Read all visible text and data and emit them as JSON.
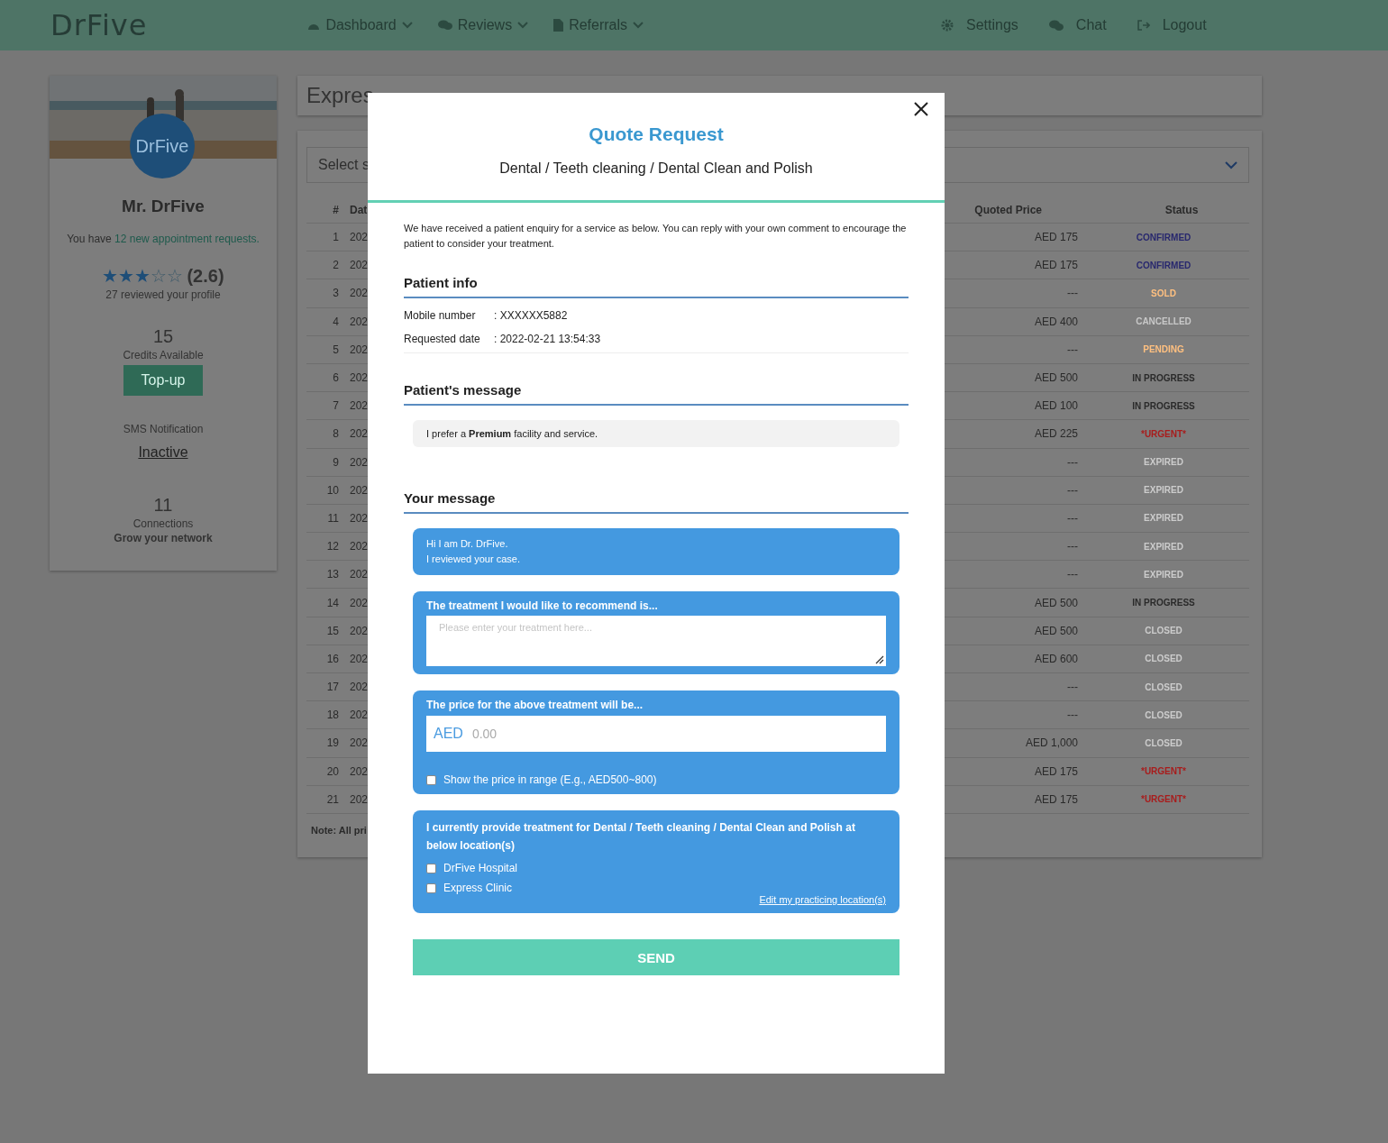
{
  "nav": {
    "logo": "DrFive",
    "menus": [
      {
        "label": "Dashboard"
      },
      {
        "label": "Reviews"
      },
      {
        "label": "Referrals"
      }
    ],
    "actions": [
      {
        "label": "Settings"
      },
      {
        "label": "Chat"
      },
      {
        "label": "Logout"
      }
    ]
  },
  "profile": {
    "avatar": "DrFive",
    "name": "Mr. DrFive",
    "notice": "You have ",
    "notice_link": "12 new appointment requests.",
    "stars": 3,
    "rating": "(2.6)",
    "reviews": "27 reviewed your profile",
    "credits": "15",
    "credits_label": "Credits Available",
    "topup": "Top-up",
    "sms_label": "SMS Notification",
    "sms_status": "Inactive",
    "connections": "11",
    "connections_label": "Connections",
    "grow": "Grow your network"
  },
  "main": {
    "title": "Expres",
    "select_placeholder": "Select s",
    "columns": [
      "#",
      "Dat",
      "Quoted Price",
      "Status"
    ],
    "note": "Note: All pri",
    "rows": [
      {
        "n": "1",
        "date": "202",
        "price": "AED 175",
        "status": "CONFIRMED",
        "color": "#28286e"
      },
      {
        "n": "2",
        "date": "202",
        "price": "AED 175",
        "status": "CONFIRMED",
        "color": "#28286e"
      },
      {
        "n": "3",
        "date": "202",
        "price": "---",
        "status": "SOLD",
        "color": "#ffc080"
      },
      {
        "n": "4",
        "date": "202",
        "price": "AED 400",
        "status": "CANCELLED",
        "color": "#c8c8c8"
      },
      {
        "n": "5",
        "date": "202",
        "price": "---",
        "status": "PENDING",
        "color": "#ffc080"
      },
      {
        "n": "6",
        "date": "202",
        "price": "AED 500",
        "status": "IN PROGRESS",
        "color": "#2a2a2a"
      },
      {
        "n": "7",
        "date": "202",
        "price": "AED 100",
        "status": "IN PROGRESS",
        "color": "#2a2a2a"
      },
      {
        "n": "8",
        "date": "202",
        "price": "AED 225",
        "status": "*URGENT*",
        "color": "#a81c1c"
      },
      {
        "n": "9",
        "date": "202",
        "price": "---",
        "status": "EXPIRED",
        "color": "#cccccc"
      },
      {
        "n": "10",
        "date": "202",
        "price": "---",
        "status": "EXPIRED",
        "color": "#cccccc"
      },
      {
        "n": "11",
        "date": "202",
        "price": "---",
        "status": "EXPIRED",
        "color": "#cccccc"
      },
      {
        "n": "12",
        "date": "202",
        "price": "---",
        "status": "EXPIRED",
        "color": "#cccccc"
      },
      {
        "n": "13",
        "date": "202",
        "price": "---",
        "status": "EXPIRED",
        "color": "#cccccc"
      },
      {
        "n": "14",
        "date": "202",
        "price": "AED 500",
        "status": "IN PROGRESS",
        "color": "#2a2a2a"
      },
      {
        "n": "15",
        "date": "202",
        "price": "AED 500",
        "status": "CLOSED",
        "color": "#cccccc"
      },
      {
        "n": "16",
        "date": "202",
        "price": "AED 600",
        "status": "CLOSED",
        "color": "#cccccc"
      },
      {
        "n": "17",
        "date": "202",
        "price": "---",
        "status": "CLOSED",
        "color": "#cccccc"
      },
      {
        "n": "18",
        "date": "202",
        "price": "---",
        "status": "CLOSED",
        "color": "#cccccc"
      },
      {
        "n": "19",
        "date": "202",
        "price": "AED 1,000",
        "status": "CLOSED",
        "color": "#cccccc"
      },
      {
        "n": "20",
        "date": "202",
        "price": "AED 175",
        "status": "*URGENT*",
        "color": "#a81c1c"
      },
      {
        "n": "21",
        "date": "202",
        "price": "AED 175",
        "status": "*URGENT*",
        "color": "#a81c1c"
      }
    ]
  },
  "modal": {
    "title": "Quote Request",
    "subtitle": "Dental / Teeth cleaning / Dental Clean and Polish",
    "intro": "We have received a patient enquiry for a service as below. You can reply with your own comment to encourage the patient to consider your treatment.",
    "patient_info": {
      "heading": "Patient info",
      "fields": [
        {
          "label": "Mobile number",
          "value": ": XXXXXX5882"
        },
        {
          "label": "Requested date",
          "value": ": 2022-02-21 13:54:33"
        }
      ]
    },
    "patient_message": {
      "heading": "Patient's message",
      "text": "I prefer a **Premium** facility and service."
    },
    "your_message": {
      "heading": "Your message",
      "greeting": [
        "Hi I am Dr. DrFive.",
        "I reviewed your case."
      ],
      "treatment": {
        "label": "The treatment I would like to recommend is...",
        "placeholder": "Please enter your treatment here..."
      },
      "price": {
        "label": "The price for the above treatment will be...",
        "prefix": "AED",
        "placeholder": "0.00",
        "range": {
          "label": "Show the price in range (E.g., AED500~800)",
          "checked": false
        }
      },
      "locations": {
        "label": "I currently provide treatment for Dental / Teeth cleaning / Dental Clean and Polish at below location(s)",
        "items": [
          {
            "label": "DrFive Hospital",
            "checked": false
          },
          {
            "label": "Express Clinic",
            "checked": false
          }
        ],
        "edit_link": "Edit my practicing location(s)"
      }
    },
    "send": "SEND"
  }
}
